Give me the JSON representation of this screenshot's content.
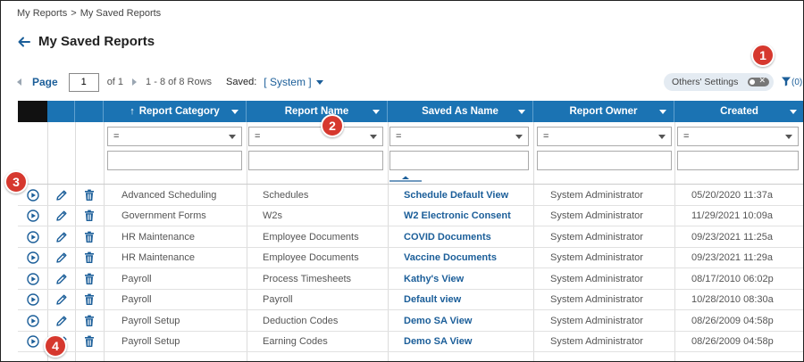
{
  "breadcrumb": {
    "items": [
      "My Reports",
      "My Saved Reports"
    ],
    "separator": ">"
  },
  "page": {
    "title": "My Saved Reports"
  },
  "pager": {
    "page_label": "Page",
    "page_value": "1",
    "of_text": "of 1",
    "rows_text": "1 - 8 of 8 Rows",
    "saved_label": "Saved:",
    "saved_value": "[ System ]"
  },
  "toolbar": {
    "others_settings_label": "Others' Settings",
    "toggle_off_glyph": "✕",
    "filter_count": "(0)"
  },
  "colors": {
    "header_bg": "#1b73b3",
    "link": "#1b5e99",
    "badge": "#d6382e"
  },
  "columns": [
    {
      "label": "Report Category",
      "sorted": "asc",
      "sort_glyph": "↑"
    },
    {
      "label": "Report Name"
    },
    {
      "label": "Saved As Name"
    },
    {
      "label": "Report Owner"
    },
    {
      "label": "Created"
    }
  ],
  "filter_operator": "=",
  "rows": [
    {
      "category": "Advanced Scheduling",
      "report": "Schedules",
      "saved_as": "Schedule Default View",
      "owner": "System Administrator",
      "created": "05/20/2020 11:37a"
    },
    {
      "category": "Government Forms",
      "report": "W2s",
      "saved_as": "W2 Electronic Consent",
      "owner": "System Administrator",
      "created": "11/29/2021 10:09a"
    },
    {
      "category": "HR Maintenance",
      "report": "Employee Documents",
      "saved_as": "COVID Documents",
      "owner": "System Administrator",
      "created": "09/23/2021 11:25a"
    },
    {
      "category": "HR Maintenance",
      "report": "Employee Documents",
      "saved_as": "Vaccine Documents",
      "owner": "System Administrator",
      "created": "09/23/2021 11:29a"
    },
    {
      "category": "Payroll",
      "report": "Process Timesheets",
      "saved_as": "Kathy's View",
      "owner": "System Administrator",
      "created": "08/17/2010 06:02p"
    },
    {
      "category": "Payroll",
      "report": "Payroll",
      "saved_as": "Default view",
      "owner": "System Administrator",
      "created": "10/28/2010 08:30a"
    },
    {
      "category": "Payroll Setup",
      "report": "Deduction Codes",
      "saved_as": "Demo SA View",
      "owner": "System Administrator",
      "created": "08/26/2009 04:58p"
    },
    {
      "category": "Payroll Setup",
      "report": "Earning Codes",
      "saved_as": "Demo SA View",
      "owner": "System Administrator",
      "created": "08/26/2009 04:58p"
    }
  ],
  "callouts": [
    "1",
    "2",
    "3",
    "4"
  ],
  "icons": {
    "run": "play-circle-icon",
    "edit": "pencil-icon",
    "delete": "trash-icon",
    "back": "arrow-left-icon",
    "filter": "funnel-icon"
  }
}
